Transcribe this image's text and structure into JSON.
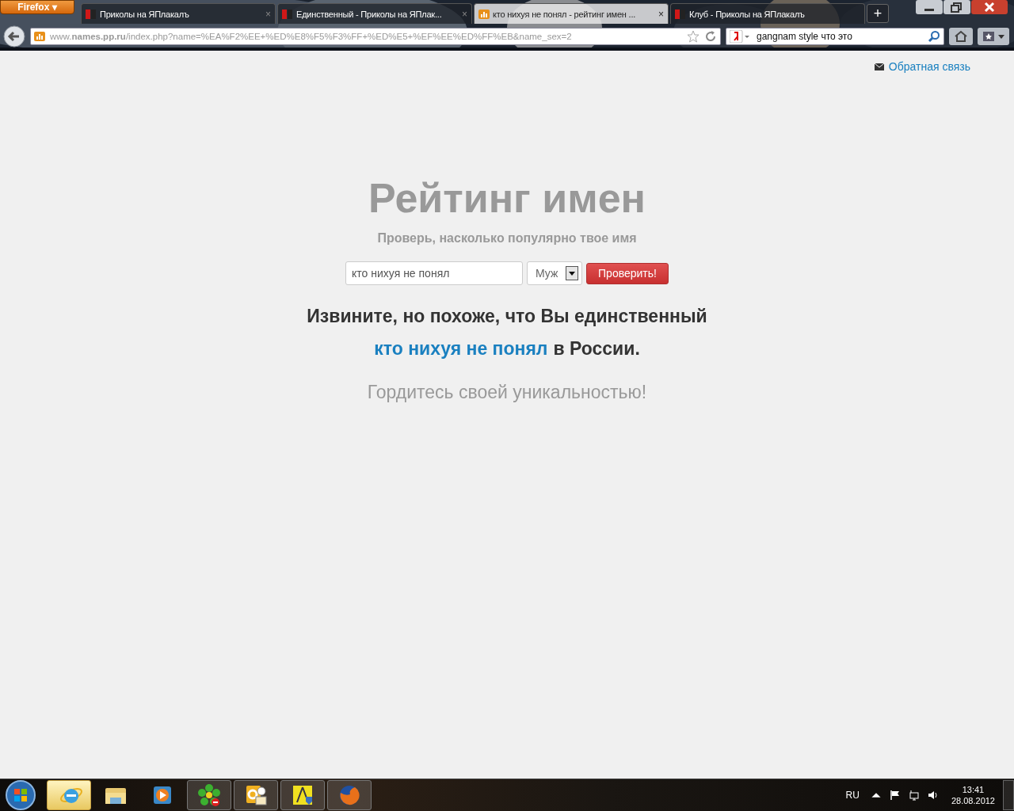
{
  "browser": {
    "menu_button": "Firefox ▾",
    "tabs": [
      {
        "title": "Приколы на ЯПлакалъ",
        "kind": "yap",
        "selected": false,
        "close": "×"
      },
      {
        "title": "Единственный - Приколы на ЯПлак...",
        "kind": "yap",
        "selected": false,
        "close": "×"
      },
      {
        "title": "кто нихуя не понял - рейтинг имен ...",
        "kind": "chart",
        "selected": true,
        "close": "×"
      },
      {
        "title": "Клуб - Приколы на ЯПлакалъ",
        "kind": "yap",
        "selected": false
      }
    ],
    "new_tab": "+",
    "url": "www.**names.pp.ru**/index.php?name=%EA%F2%EE+%ED%E8%F5%F3%FF+%ED%E5+%EF%EE%ED%FF%EB&name_sex=2",
    "search_value": "gangnam style что это"
  },
  "page": {
    "feedback_link": "Обратная связь",
    "title": "Рейтинг имен",
    "subtitle": "Проверь, насколько популярно твое имя",
    "name_input": "кто нихуя не понял",
    "sex_select": "Муж",
    "check_button": "Проверить!",
    "result_line1": "Извините, но похоже, что Вы единственный",
    "result_name": "кто нихуя не понял",
    "result_rest": "в России.",
    "proud": "Гордитесь своей уникальностью!"
  },
  "taskbar": {
    "apps": [
      {
        "kind": "ie",
        "running": true,
        "selected": true
      },
      {
        "kind": "folder",
        "running": false,
        "selected": false
      },
      {
        "kind": "media",
        "running": false,
        "selected": false
      },
      {
        "kind": "icq",
        "running": true,
        "selected": false
      },
      {
        "kind": "outlook",
        "running": true,
        "selected": false
      },
      {
        "kind": "tool",
        "running": true,
        "selected": false
      },
      {
        "kind": "firefox",
        "running": true,
        "selected": false
      }
    ],
    "language": "RU",
    "time": "13:41",
    "date": "28.08.2012"
  }
}
